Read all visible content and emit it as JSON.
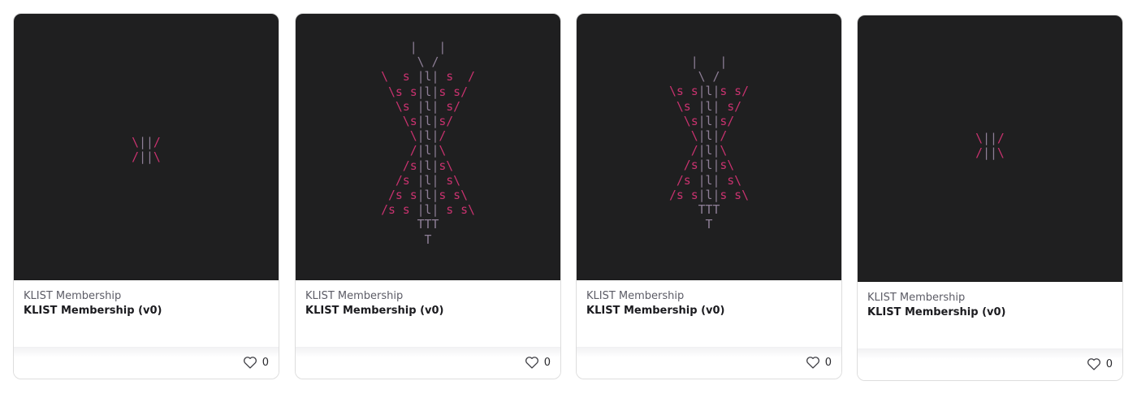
{
  "colors": {
    "art_background": "#1f1f20",
    "ascii_pink": "#c9326f",
    "ascii_gray": "#8e7f97"
  },
  "cards": [
    {
      "collection": "KLIST Membership",
      "name": "KLIST Membership (v0)",
      "likes": "0",
      "art": [
        [
          [
            "p",
            "\\"
          ],
          [
            "g",
            "||"
          ],
          [
            "p",
            "/"
          ]
        ],
        [
          [
            "p",
            "/"
          ],
          [
            "g",
            "||"
          ],
          [
            "p",
            "\\"
          ]
        ]
      ]
    },
    {
      "collection": "KLIST Membership",
      "name": "KLIST Membership (v0)",
      "likes": "0",
      "art": [
        [
          [
            "g",
            "    |   |    "
          ]
        ],
        [
          [
            "g",
            "     \\ /     "
          ]
        ],
        [
          [
            "p",
            "\\  s "
          ],
          [
            "g",
            "|l|"
          ],
          [
            "p",
            " s  /"
          ]
        ],
        [
          [
            "p",
            " \\s s"
          ],
          [
            "g",
            "|l|"
          ],
          [
            "p",
            "s s/ "
          ]
        ],
        [
          [
            "p",
            "  \\s "
          ],
          [
            "g",
            "|l|"
          ],
          [
            "p",
            " s/  "
          ]
        ],
        [
          [
            "p",
            "   \\s"
          ],
          [
            "g",
            "|l|"
          ],
          [
            "p",
            "s/   "
          ]
        ],
        [
          [
            "p",
            "    \\"
          ],
          [
            "g",
            "|l|"
          ],
          [
            "p",
            "/    "
          ]
        ],
        [
          [
            "p",
            "    /"
          ],
          [
            "g",
            "|l|"
          ],
          [
            "p",
            "\\    "
          ]
        ],
        [
          [
            "p",
            "   /s"
          ],
          [
            "g",
            "|l|"
          ],
          [
            "p",
            "s\\   "
          ]
        ],
        [
          [
            "p",
            "  /s "
          ],
          [
            "g",
            "|l|"
          ],
          [
            "p",
            " s\\  "
          ]
        ],
        [
          [
            "p",
            " /s s"
          ],
          [
            "g",
            "|l|"
          ],
          [
            "p",
            "s s\\ "
          ]
        ],
        [
          [
            "p",
            "/s s "
          ],
          [
            "g",
            "|l|"
          ],
          [
            "p",
            " s s\\"
          ]
        ],
        [
          [
            "g",
            "     TTT     "
          ]
        ],
        [
          [
            "g",
            "      T      "
          ]
        ]
      ]
    },
    {
      "collection": "KLIST Membership",
      "name": "KLIST Membership (v0)",
      "likes": "0",
      "art": [
        [
          [
            "g",
            "   |   |   "
          ]
        ],
        [
          [
            "g",
            "    \\ /    "
          ]
        ],
        [
          [
            "p",
            "\\s s"
          ],
          [
            "g",
            "|l|"
          ],
          [
            "p",
            "s s/"
          ]
        ],
        [
          [
            "p",
            " \\s "
          ],
          [
            "g",
            "|l|"
          ],
          [
            "p",
            " s/ "
          ]
        ],
        [
          [
            "p",
            "  \\s"
          ],
          [
            "g",
            "|l|"
          ],
          [
            "p",
            "s/  "
          ]
        ],
        [
          [
            "p",
            "   \\"
          ],
          [
            "g",
            "|l|"
          ],
          [
            "p",
            "/   "
          ]
        ],
        [
          [
            "p",
            "   /"
          ],
          [
            "g",
            "|l|"
          ],
          [
            "p",
            "\\   "
          ]
        ],
        [
          [
            "p",
            "  /s"
          ],
          [
            "g",
            "|l|"
          ],
          [
            "p",
            "s\\  "
          ]
        ],
        [
          [
            "p",
            " /s "
          ],
          [
            "g",
            "|l|"
          ],
          [
            "p",
            " s\\ "
          ]
        ],
        [
          [
            "p",
            "/s s"
          ],
          [
            "g",
            "|l|"
          ],
          [
            "p",
            "s s\\"
          ]
        ],
        [
          [
            "g",
            "    TTT    "
          ]
        ],
        [
          [
            "g",
            "     T     "
          ]
        ]
      ]
    },
    {
      "collection": "KLIST Membership",
      "name": "KLIST Membership (v0)",
      "likes": "0",
      "art": [
        [
          [
            "p",
            "\\"
          ],
          [
            "g",
            "||"
          ],
          [
            "p",
            "/"
          ]
        ],
        [
          [
            "p",
            "/"
          ],
          [
            "g",
            "||"
          ],
          [
            "p",
            "\\"
          ]
        ]
      ]
    }
  ]
}
